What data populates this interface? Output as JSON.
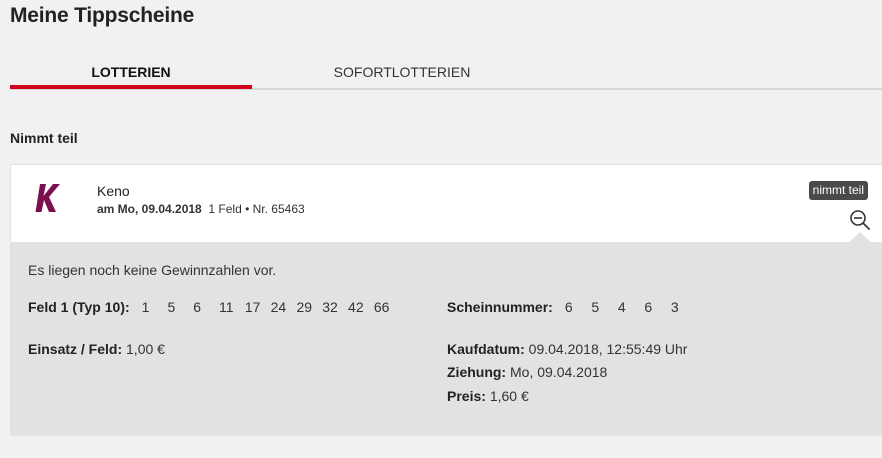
{
  "page": {
    "title": "Meine Tippscheine"
  },
  "tabs": [
    {
      "label": "LOTTERIEN",
      "active": true
    },
    {
      "label": "SOFORTLOTTERIEN",
      "active": false
    }
  ],
  "section": {
    "heading": "Nimmt teil"
  },
  "ticket": {
    "logo_letter": "K",
    "logo_color": "#7a1050",
    "game": "Keno",
    "date": "am Mo, 09.04.2018",
    "info": "1 Feld • Nr. 65463",
    "status": "nimmt teil",
    "zoom_icon": "zoom-out-icon",
    "notice": "Es liegen noch keine Gewinnzahlen vor.",
    "field": {
      "label": "Feld 1 (Typ 10):",
      "numbers": [
        "1",
        "5",
        "6",
        "11",
        "17",
        "24",
        "29",
        "32",
        "42",
        "66"
      ]
    },
    "stake": {
      "label": "Einsatz / Feld:",
      "value": "1,00 €"
    },
    "ticket_number": {
      "label": "Scheinnummer:",
      "digits": [
        "6",
        "5",
        "4",
        "6",
        "3"
      ]
    },
    "purchase": {
      "label": "Kaufdatum:",
      "value": "09.04.2018, 12:55:49 Uhr"
    },
    "draw": {
      "label": "Ziehung:",
      "value": "Mo, 09.04.2018"
    },
    "price": {
      "label": "Preis:",
      "value": "1,60 €"
    }
  },
  "colors": {
    "accent": "#d0021b",
    "background": "#f1f1f1",
    "detail_background": "#e3e2e0",
    "badge": "#4a4a4a"
  }
}
